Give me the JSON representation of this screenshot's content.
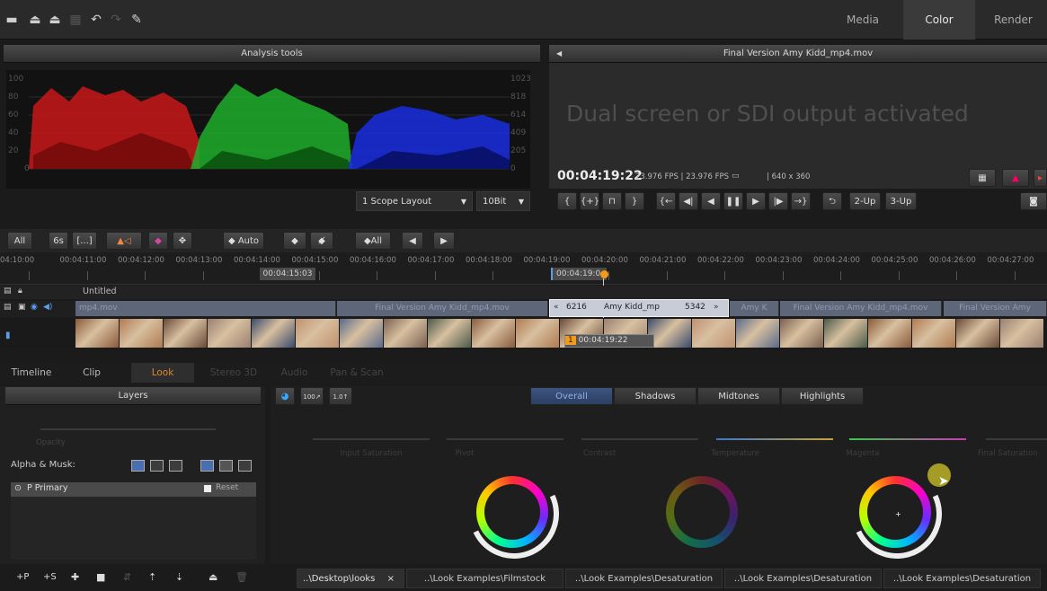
{
  "toolbar": {
    "icons": [
      "folder-open-icon",
      "import-icon",
      "export-icon",
      "film-icon",
      "undo-icon",
      "redo-icon",
      "wrench-icon"
    ],
    "modes": [
      "Media",
      "Color",
      "Render"
    ],
    "active_mode": "Color"
  },
  "analysis": {
    "title": "Analysis tools",
    "left_scale": [
      "100",
      "80",
      "60",
      "40",
      "20",
      "0"
    ],
    "right_scale": [
      "1023",
      "818",
      "614",
      "409",
      "205",
      "0"
    ],
    "layout_select": "1 Scope Layout",
    "bit_select": "10Bit"
  },
  "viewer": {
    "title": "Final Version Amy Kidd_mp4.mov",
    "message": "Dual screen or SDI output activated",
    "timecode": "00:04:19:22",
    "info": "23.976 FPS | 23.976 FPS",
    "resolution": "| 640 x 360",
    "btn_2up": "2-Up",
    "btn_3up": "3-Up"
  },
  "timeline": {
    "btn_all": "All",
    "btn_6s": "6s",
    "btn_range": "[...]",
    "btn_auto": "◆ Auto",
    "btn_keyall": "◆All",
    "ruler": [
      "04:10:00",
      "00:04:11:00",
      "00:04:12:00",
      "00:04:13:00",
      "00:04:14:00",
      "00:04:15:00",
      "00:04:16:00",
      "00:04:17:00",
      "00:04:18:00",
      "00:04:19:00",
      "00:04:20:00",
      "00:04:21:00",
      "00:04:22:00",
      "00:04:23:00",
      "00:04:24:00",
      "00:04:25:00",
      "00:04:26:00",
      "00:04:27:00"
    ],
    "marker_left": "00:04:15:03",
    "marker_playhead": "00:04:19:0",
    "track_name": "Untitled",
    "clips": [
      "mp4.mov",
      "Final Version Amy Kidd_mp4.mov",
      "Amy Kidd_mp",
      "Amy K",
      "Final Version Amy Kidd_mp4.mov",
      "Final Version Amy"
    ],
    "trim_left": "6216",
    "trim_right": "5342",
    "thumb_timecode": "00:04:19:22",
    "thumb_index": "1"
  },
  "page_tabs": [
    "Timeline",
    "Clip",
    "Look",
    "Stereo 3D",
    "Audio",
    "Pan & Scan"
  ],
  "active_page": "Look",
  "layers": {
    "title": "Layers",
    "opacity_label": "Opacity",
    "alpha_label": "Alpha & Musk:",
    "primary": "P  Primary",
    "reset": "Reset",
    "bottom_buttons": [
      "+P",
      "+S"
    ]
  },
  "look": {
    "ranges": [
      "Overall",
      "Shadows",
      "Midtones",
      "Highlights"
    ],
    "active_range": "Overall",
    "params": [
      "Input Saturation",
      "Pivot",
      "Contrast",
      "Temperature",
      "Magenta",
      "Final Saturation"
    ]
  },
  "paths": [
    "..\\Desktop\\looks",
    "..\\Look Examples\\Filmstock",
    "..\\Look Examples\\Desaturation",
    "..\\Look Examples\\Desaturation",
    "..\\Look Examples\\Desaturation"
  ],
  "path_close": "×"
}
